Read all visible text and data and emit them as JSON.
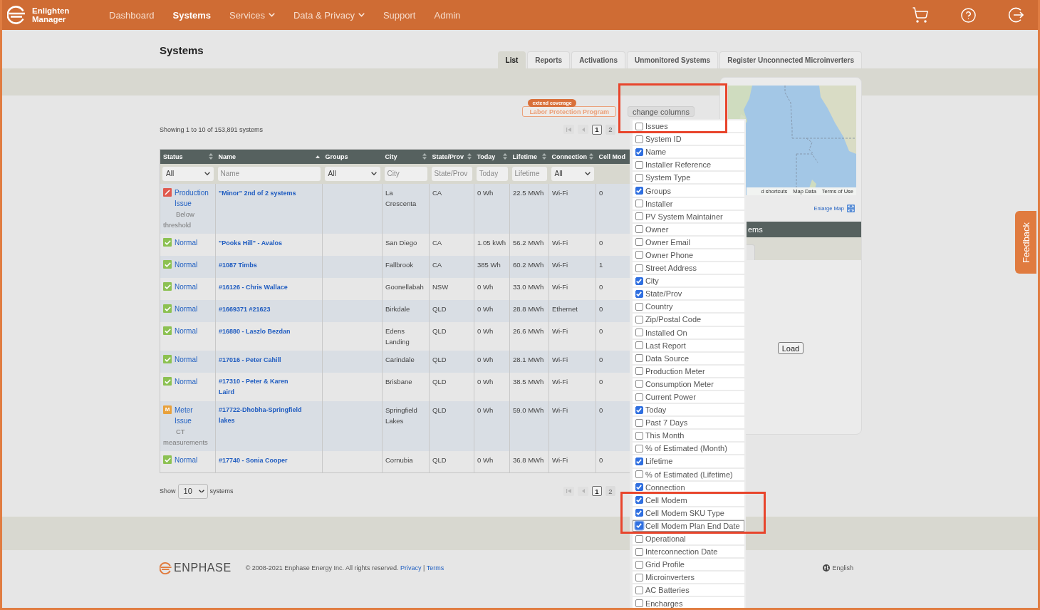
{
  "header": {
    "brand": "Enlighten Manager",
    "nav": [
      {
        "label": "Dashboard",
        "selected": false,
        "has_menu": false
      },
      {
        "label": "Systems",
        "selected": true,
        "has_menu": false
      },
      {
        "label": "Services",
        "selected": false,
        "has_menu": true
      },
      {
        "label": "Data & Privacy",
        "selected": false,
        "has_menu": true
      },
      {
        "label": "Support",
        "selected": false,
        "has_menu": false
      },
      {
        "label": "Admin",
        "selected": false,
        "has_menu": false
      }
    ]
  },
  "page_title": "Systems",
  "tabs": [
    {
      "label": "List",
      "selected": true
    },
    {
      "label": "Reports",
      "selected": false
    },
    {
      "label": "Activations",
      "selected": false
    },
    {
      "label": "Unmonitored Systems",
      "selected": false
    },
    {
      "label": "Register Unconnected Microinverters",
      "selected": false
    }
  ],
  "toolbar": {
    "promo_badge": "extend coverage",
    "promo_button": "Labor Protection Program",
    "columns_button": "change columns"
  },
  "list_header": {
    "summary": "Showing 1 to 10 of 153,891 systems",
    "pagination": {
      "back_disabled": true,
      "pages": [
        {
          "label": "1",
          "selected": true
        },
        {
          "label": "2",
          "selected": false
        }
      ]
    }
  },
  "table": {
    "columns": [
      {
        "label": "Status",
        "sortable": true,
        "sorted": false
      },
      {
        "label": "Name",
        "sortable": true,
        "sorted": true
      },
      {
        "label": "Groups",
        "sortable": false,
        "sorted": false
      },
      {
        "label": "City",
        "sortable": true,
        "sorted": false
      },
      {
        "label": "State/Prov",
        "sortable": true,
        "sorted": false
      },
      {
        "label": "Today",
        "sortable": true,
        "sorted": false
      },
      {
        "label": "Lifetime",
        "sortable": true,
        "sorted": false
      },
      {
        "label": "Connection",
        "sortable": true,
        "sorted": false
      },
      {
        "label": "Cell Mod",
        "sortable": false,
        "sorted": false
      }
    ],
    "filters": [
      {
        "kind": "select",
        "value": "All"
      },
      {
        "kind": "text",
        "placeholder": "Name"
      },
      {
        "kind": "select",
        "value": "All"
      },
      {
        "kind": "text",
        "placeholder": "City"
      },
      {
        "kind": "text",
        "placeholder": "State/Prov"
      },
      {
        "kind": "text",
        "placeholder": "Today"
      },
      {
        "kind": "text",
        "placeholder": "Lifetime"
      },
      {
        "kind": "select",
        "value": "All"
      }
    ],
    "rows": [
      {
        "status": {
          "kind": "production_issue",
          "label": "Production Issue",
          "detail": "Below threshold"
        },
        "name": "\"Minor\" 2nd of 2 systems",
        "city": "La Crescenta",
        "state": "CA",
        "today": "0 Wh",
        "lifetime": "22.5 MWh",
        "connection": "Wi-Fi",
        "cell_modem": "0"
      },
      {
        "status": {
          "kind": "normal",
          "label": "Normal"
        },
        "name": "\"Pooks Hill\" - Avalos",
        "city": "San Diego",
        "state": "CA",
        "today": "1.05 kWh",
        "lifetime": "56.2 MWh",
        "connection": "Wi-Fi",
        "cell_modem": "0"
      },
      {
        "status": {
          "kind": "normal",
          "label": "Normal"
        },
        "name": "#1087 Timbs",
        "city": "Fallbrook",
        "state": "CA",
        "today": "385 Wh",
        "lifetime": "60.2 MWh",
        "connection": "Wi-Fi",
        "cell_modem": "1"
      },
      {
        "status": {
          "kind": "normal",
          "label": "Normal"
        },
        "name": "#16126 - Chris Wallace",
        "city": "Goonellabah",
        "state": "NSW",
        "today": "0 Wh",
        "lifetime": "33.0 MWh",
        "connection": "Wi-Fi",
        "cell_modem": "0"
      },
      {
        "status": {
          "kind": "normal",
          "label": "Normal"
        },
        "name": "#1669371 #21623",
        "city": "Birkdale",
        "state": "QLD",
        "today": "0 Wh",
        "lifetime": "28.8 MWh",
        "connection": "Ethernet",
        "cell_modem": "0"
      },
      {
        "status": {
          "kind": "normal",
          "label": "Normal"
        },
        "name": "#16880 - Laszlo Bezdan",
        "city": "Edens Landing",
        "state": "QLD",
        "today": "0 Wh",
        "lifetime": "26.6 MWh",
        "connection": "Wi-Fi",
        "cell_modem": "0"
      },
      {
        "status": {
          "kind": "normal",
          "label": "Normal"
        },
        "name": "#17016 - Peter Cahill",
        "city": "Carindale",
        "state": "QLD",
        "today": "0 Wh",
        "lifetime": "28.1 MWh",
        "connection": "Wi-Fi",
        "cell_modem": "0"
      },
      {
        "status": {
          "kind": "normal",
          "label": "Normal"
        },
        "name": "#17310 - Peter & Karen Laird",
        "city": "Brisbane",
        "state": "QLD",
        "today": "0 Wh",
        "lifetime": "38.5 MWh",
        "connection": "Wi-Fi",
        "cell_modem": "0"
      },
      {
        "status": {
          "kind": "meter_issue",
          "badge": "M",
          "label": "Meter Issue",
          "detail": "CT measurements"
        },
        "name": "#17722-Dhobha-Springfield lakes",
        "city": "Springfield Lakes",
        "state": "QLD",
        "today": "0 Wh",
        "lifetime": "59.0 MWh",
        "connection": "Wi-Fi",
        "cell_modem": "0"
      },
      {
        "status": {
          "kind": "normal",
          "label": "Normal"
        },
        "name": "#17740 - Sonia Cooper",
        "city": "Cornubia",
        "state": "QLD",
        "today": "0 Wh",
        "lifetime": "36.8 MWh",
        "connection": "Wi-Fi",
        "cell_modem": "0"
      }
    ]
  },
  "list_footer": {
    "page_size": {
      "prefix": "Show",
      "value": "10",
      "suffix": "systems"
    },
    "pagination": {
      "back_disabled": true,
      "pages": [
        {
          "label": "1",
          "selected": true
        },
        {
          "label": "2",
          "selected": false
        }
      ]
    }
  },
  "column_menu": [
    {
      "label": "Issues",
      "checked": false,
      "focused": false
    },
    {
      "label": "System ID",
      "checked": false,
      "focused": false
    },
    {
      "label": "Name",
      "checked": true,
      "focused": false
    },
    {
      "label": "Installer Reference",
      "checked": false,
      "focused": false
    },
    {
      "label": "System Type",
      "checked": false,
      "focused": false
    },
    {
      "label": "Groups",
      "checked": true,
      "focused": false
    },
    {
      "label": "Installer",
      "checked": false,
      "focused": false
    },
    {
      "label": "PV System Maintainer",
      "checked": false,
      "focused": false
    },
    {
      "label": "Owner",
      "checked": false,
      "focused": false
    },
    {
      "label": "Owner Email",
      "checked": false,
      "focused": false
    },
    {
      "label": "Owner Phone",
      "checked": false,
      "focused": false
    },
    {
      "label": "Street Address",
      "checked": false,
      "focused": false
    },
    {
      "label": "City",
      "checked": true,
      "focused": false
    },
    {
      "label": "State/Prov",
      "checked": true,
      "focused": false
    },
    {
      "label": "Country",
      "checked": false,
      "focused": false
    },
    {
      "label": "Zip/Postal Code",
      "checked": false,
      "focused": false
    },
    {
      "label": "Installed On",
      "checked": false,
      "focused": false
    },
    {
      "label": "Last Report",
      "checked": false,
      "focused": false
    },
    {
      "label": "Data Source",
      "checked": false,
      "focused": false
    },
    {
      "label": "Production Meter",
      "checked": false,
      "focused": false
    },
    {
      "label": "Consumption Meter",
      "checked": false,
      "focused": false
    },
    {
      "label": "Current Power",
      "checked": false,
      "focused": false
    },
    {
      "label": "Today",
      "checked": true,
      "focused": false
    },
    {
      "label": "Past 7 Days",
      "checked": false,
      "focused": false
    },
    {
      "label": "This Month",
      "checked": false,
      "focused": false
    },
    {
      "label": "% of Estimated (Month)",
      "checked": false,
      "focused": false
    },
    {
      "label": "Lifetime",
      "checked": true,
      "focused": false
    },
    {
      "label": "% of Estimated (Lifetime)",
      "checked": false,
      "focused": false
    },
    {
      "label": "Connection",
      "checked": true,
      "focused": false
    },
    {
      "label": "Cell Modem",
      "checked": true,
      "focused": false
    },
    {
      "label": "Cell Modem SKU Type",
      "checked": true,
      "focused": false
    },
    {
      "label": "Cell Modem Plan End Date",
      "checked": true,
      "focused": true
    },
    {
      "label": "Operational",
      "checked": false,
      "focused": false
    },
    {
      "label": "Interconnection Date",
      "checked": false,
      "focused": false
    },
    {
      "label": "Grid Profile",
      "checked": false,
      "focused": false
    },
    {
      "label": "Microinverters",
      "checked": false,
      "focused": false
    },
    {
      "label": "AC Batteries",
      "checked": false,
      "focused": false
    },
    {
      "label": "Encharges",
      "checked": false,
      "focused": false
    }
  ],
  "map_panel": {
    "attribution": [
      "d shortcuts",
      "Map Data",
      "Terms of Use"
    ],
    "enlarge_link": "Enlarge Map",
    "bar_title": "ems",
    "load_button": "Load"
  },
  "feedback_tab": "Feedback",
  "footer": {
    "brand": "ENPHASE",
    "copyright": "© 2008-2021 Enphase Energy Inc. All rights reserved.",
    "links": [
      "Privacy",
      "Terms"
    ],
    "separator": "|",
    "language": "English"
  }
}
